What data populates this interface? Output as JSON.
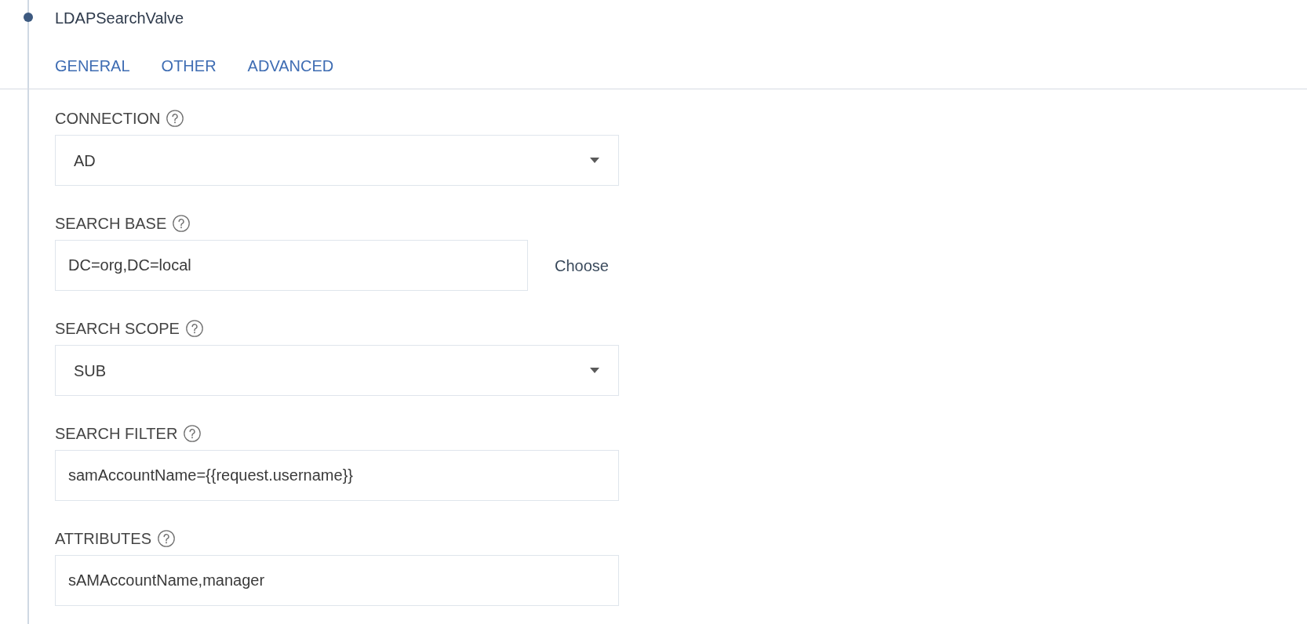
{
  "node": {
    "title": "LDAPSearchValve"
  },
  "tabs": [
    {
      "label": "GENERAL"
    },
    {
      "label": "OTHER"
    },
    {
      "label": "ADVANCED"
    }
  ],
  "fields": [
    {
      "kind": "select",
      "label": "CONNECTION",
      "value": "AD"
    },
    {
      "kind": "text",
      "label": "SEARCH BASE",
      "value": "DC=org,DC=local",
      "action": "Choose"
    },
    {
      "kind": "select",
      "label": "SEARCH SCOPE",
      "value": "SUB"
    },
    {
      "kind": "text",
      "label": "SEARCH FILTER",
      "value": "samAccountName={{request.username}}"
    },
    {
      "kind": "text",
      "label": "ATTRIBUTES",
      "value": "sAMAccountName,manager"
    }
  ]
}
